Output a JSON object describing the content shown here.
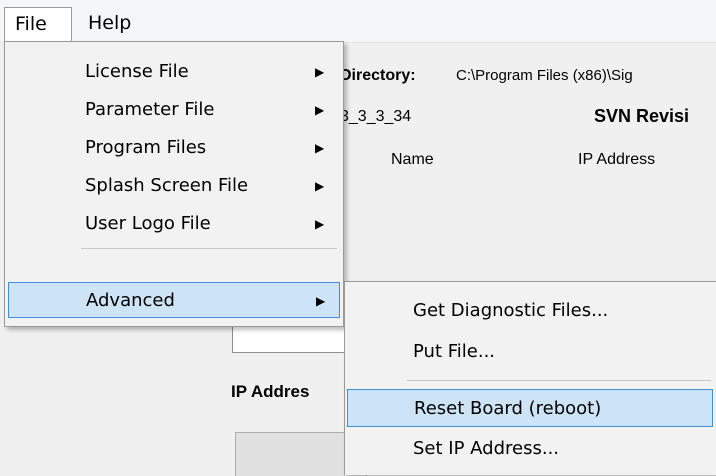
{
  "menubar": {
    "file": "File",
    "help": "Help"
  },
  "background": {
    "directory_label": "Directory:",
    "directory_value": "C:\\Program Files (x86)\\Sig",
    "version_value": "3_3_3_34",
    "svn_label": "SVN Revisi",
    "col_name": "Name",
    "col_ip": "IP Address",
    "ip_address_label": "IP Addres"
  },
  "file_menu": {
    "items": [
      {
        "label": "License File"
      },
      {
        "label": "Parameter File"
      },
      {
        "label": "Program Files"
      },
      {
        "label": "Splash Screen File"
      },
      {
        "label": "User Logo File"
      },
      {
        "label": "Advanced"
      }
    ],
    "arrow": "▶"
  },
  "advanced_menu": {
    "items": [
      {
        "label": "Get Diagnostic Files..."
      },
      {
        "label": "Put File..."
      },
      {
        "label": "Reset Board (reboot)"
      },
      {
        "label": "Set IP Address..."
      }
    ]
  },
  "colors": {
    "highlight": "#cde4f7",
    "highlight_border": "#3f8fd6",
    "menu_bg": "#f2f2f2"
  }
}
